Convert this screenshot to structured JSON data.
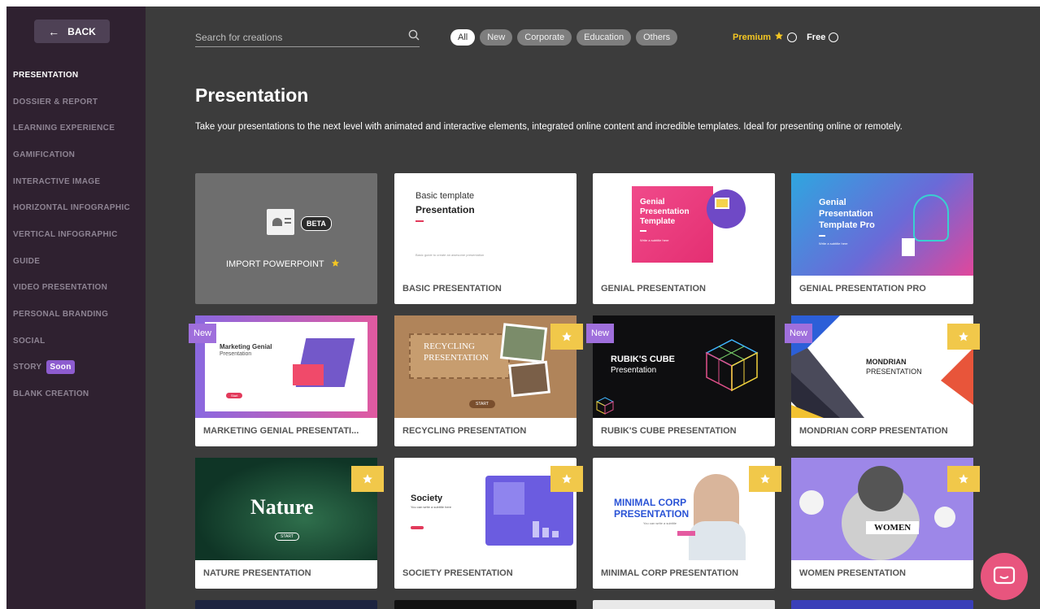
{
  "sidebar": {
    "back_label": "BACK",
    "items": [
      {
        "label": "PRESENTATION"
      },
      {
        "label": "DOSSIER & REPORT"
      },
      {
        "label": "LEARNING EXPERIENCE"
      },
      {
        "label": "GAMIFICATION"
      },
      {
        "label": "INTERACTIVE IMAGE"
      },
      {
        "label": "HORIZONTAL INFOGRAPHIC"
      },
      {
        "label": "VERTICAL INFOGRAPHIC"
      },
      {
        "label": "GUIDE"
      },
      {
        "label": "VIDEO PRESENTATION"
      },
      {
        "label": "PERSONAL BRANDING"
      },
      {
        "label": "SOCIAL"
      },
      {
        "label": "STORY",
        "badge": "Soon"
      },
      {
        "label": "BLANK CREATION"
      }
    ]
  },
  "search": {
    "placeholder": "Search for creations"
  },
  "filters": [
    "All",
    "New",
    "Corporate",
    "Education",
    "Others"
  ],
  "plan_toggle": {
    "premium": "Premium",
    "free": "Free"
  },
  "page": {
    "title": "Presentation",
    "description": "Take your presentations to the next level with animated and interactive elements, integrated online content and incredible templates. Ideal for presenting online or remotely."
  },
  "badges": {
    "new": "New",
    "beta": "BETA"
  },
  "cards": [
    {
      "label": "IMPORT POWERPOINT"
    },
    {
      "label": "BASIC PRESENTATION",
      "thumb_lines": [
        "Basic template",
        "Presentation",
        "Basic guide to create an awesome presentation"
      ]
    },
    {
      "label": "GENIAL PRESENTATION",
      "thumb_lines": [
        "Genial",
        "Presentation",
        "Template",
        "Write a subtitle here"
      ]
    },
    {
      "label": "GENIAL PRESENTATION PRO",
      "thumb_lines": [
        "Genial",
        "Presentation",
        "Template Pro",
        "Write a subtitle here"
      ]
    },
    {
      "label": "MARKETING GENIAL PRESENTATI...",
      "thumb_lines": [
        "Marketing Genial",
        "Presentation",
        "Start"
      ]
    },
    {
      "label": "RECYCLING PRESENTATION",
      "thumb_lines": [
        "RECYCLING",
        "PRESENTATION",
        "START"
      ]
    },
    {
      "label": "RUBIK'S CUBE PRESENTATION",
      "thumb_lines": [
        "RUBIK'S CUBE",
        "Presentation"
      ]
    },
    {
      "label": "MONDRIAN CORP PRESENTATION",
      "thumb_lines": [
        "MONDRIAN",
        "PRESENTATION"
      ]
    },
    {
      "label": "NATURE PRESENTATION",
      "thumb_lines": [
        "Nature",
        "START"
      ]
    },
    {
      "label": "SOCIETY PRESENTATION",
      "thumb_lines": [
        "Society",
        "You can write a subtitle here"
      ]
    },
    {
      "label": "MINIMAL CORP PRESENTATION",
      "thumb_lines": [
        "MINIMAL CORP",
        "PRESENTATION",
        "You can write a subtitle"
      ]
    },
    {
      "label": "WOMEN PRESENTATION",
      "thumb_lines": [
        "WOMEN"
      ]
    }
  ],
  "colors": {
    "sidebar_bg": "#2f2130",
    "main_bg": "#3c3c3c",
    "premium": "#f3c623",
    "new_badge": "#9f6fdc",
    "star_badge": "#f1c84a",
    "chat": "#e8557e"
  },
  "icons": {
    "back": "arrow-left-icon",
    "search": "search-icon",
    "premium": "star-icon",
    "chat": "chat-bubble-icon"
  }
}
